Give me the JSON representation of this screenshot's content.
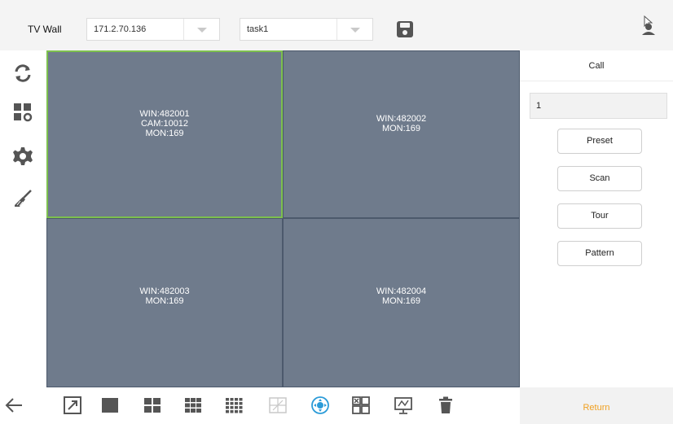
{
  "header": {
    "title": "TV Wall",
    "device_select": {
      "value": "171.2.70.136"
    },
    "task_select": {
      "value": "task1"
    },
    "icons": {
      "save": "save-icon",
      "user": "user-icon"
    }
  },
  "left_toolbar": {
    "items": [
      {
        "icon": "refresh-icon"
      },
      {
        "icon": "layout-settings-icon"
      },
      {
        "icon": "gear-icon"
      },
      {
        "icon": "clear-brush-icon"
      }
    ]
  },
  "panes": [
    {
      "lines": [
        "WIN:482001",
        "CAM:10012",
        "MON:169"
      ],
      "selected": true
    },
    {
      "lines": [
        "WIN:482002",
        "MON:169"
      ],
      "selected": false
    },
    {
      "lines": [
        "WIN:482003",
        "MON:169"
      ],
      "selected": false
    },
    {
      "lines": [
        "WIN:482004",
        "MON:169"
      ],
      "selected": false
    }
  ],
  "right_panel": {
    "title": "Call",
    "input_value": "1",
    "buttons": [
      "Preset",
      "Scan",
      "Tour",
      "Pattern"
    ],
    "return_label": "Return"
  },
  "bottom_toolbar": {
    "icons": [
      "back-arrow-icon",
      "fullscreen-icon",
      "split-1-icon",
      "split-4-icon",
      "split-9-icon",
      "split-16-icon",
      "custom-split-icon",
      "ptz-control-icon",
      "window-layout-icon",
      "monitor-icon",
      "delete-icon"
    ]
  },
  "colors": {
    "pane": "#6f7b8c",
    "selected_border": "#7dc04e",
    "accent_blue": "#2b9bd8",
    "return_text": "#f0a020",
    "icon_dark": "#555555"
  }
}
